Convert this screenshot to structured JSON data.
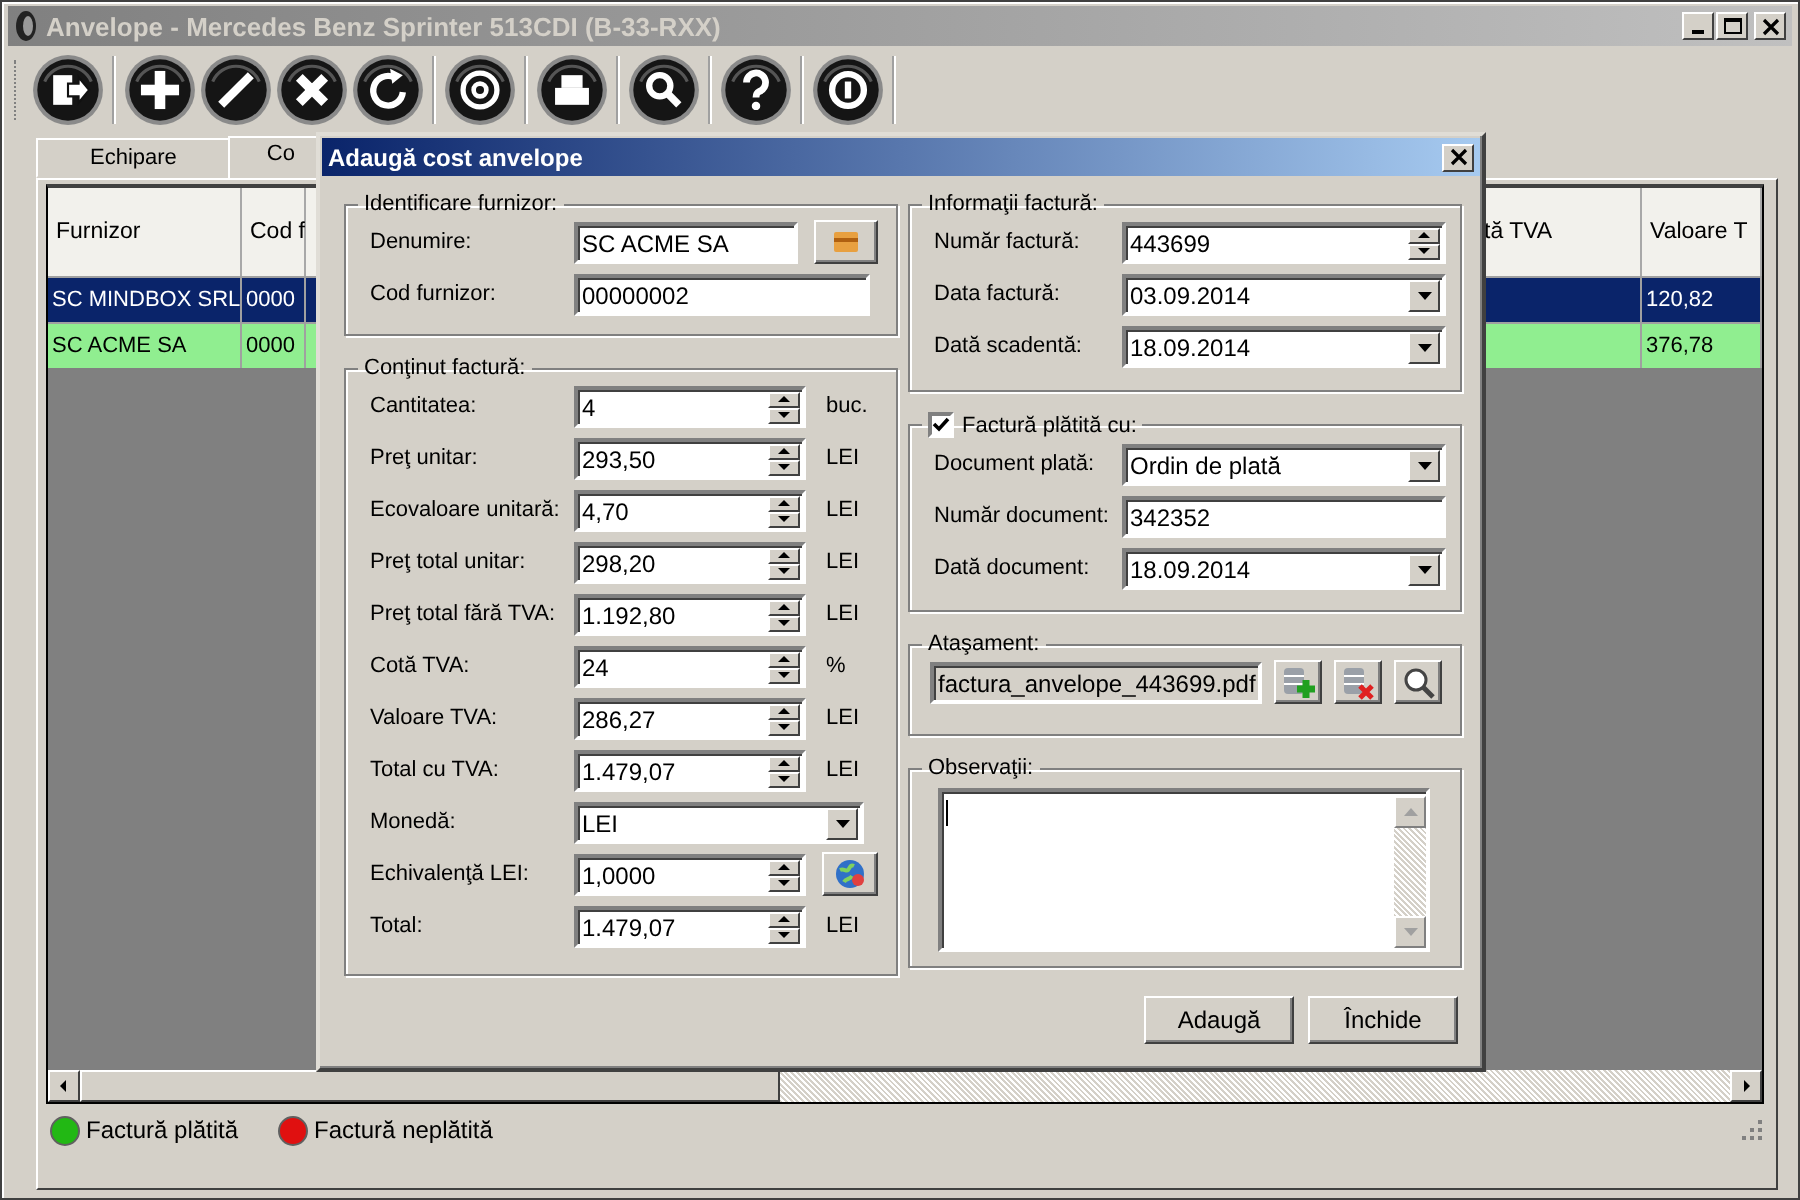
{
  "window": {
    "title": "Anvelope - Mercedes Benz Sprinter 513CDI (B-33-RXX)"
  },
  "tabs": [
    {
      "label": "Echipare",
      "selected": false
    },
    {
      "label": "Co",
      "selected": true
    }
  ],
  "table": {
    "columns": [
      "Furnizor",
      "Cod f",
      "tă TVA",
      "Valoare T"
    ],
    "rows": [
      {
        "cells": [
          "SC MINDBOX SRL",
          "0000",
          null,
          "120,82"
        ],
        "selected": true
      },
      {
        "cells": [
          "SC ACME SA",
          "0000",
          null,
          "376,78"
        ],
        "selected": false,
        "color": "#90ee90"
      }
    ]
  },
  "legend": [
    {
      "label": "Factură plătită",
      "color": "#22b814"
    },
    {
      "label": "Factură neplătită",
      "color": "#e01010"
    }
  ],
  "dialog": {
    "title": "Adaugă cost anvelope",
    "supplier": {
      "legend": "Identificare furnizor:",
      "fields": [
        {
          "label": "Denumire:",
          "value": "SC ACME SA",
          "kind": "browse"
        },
        {
          "label": "Cod furnizor:",
          "value": "00000002",
          "kind": "text"
        }
      ]
    },
    "content": {
      "legend": "Conţinut factură:",
      "fields": [
        {
          "label": "Cantitatea:",
          "value": "4",
          "unit": "buc.",
          "kind": "spin"
        },
        {
          "label": "Preţ unitar:",
          "value": "293,50",
          "unit": "LEI",
          "kind": "spin"
        },
        {
          "label": "Ecovaloare unitară:",
          "value": "4,70",
          "unit": "LEI",
          "kind": "spin"
        },
        {
          "label": "Preţ total unitar:",
          "value": "298,20",
          "unit": "LEI",
          "kind": "spin"
        },
        {
          "label": "Preţ total fără TVA:",
          "value": "1.192,80",
          "unit": "LEI",
          "kind": "spin"
        },
        {
          "label": "Cotă TVA:",
          "value": "24",
          "unit": "%",
          "kind": "spin"
        },
        {
          "label": "Valoare TVA:",
          "value": "286,27",
          "unit": "LEI",
          "kind": "spin"
        },
        {
          "label": "Total cu TVA:",
          "value": "1.479,07",
          "unit": "LEI",
          "kind": "spin"
        },
        {
          "label": "Monedă:",
          "value": "LEI",
          "kind": "combo"
        },
        {
          "label": "Echivalenţă LEI:",
          "value": "1,0000",
          "kind": "spin-globe"
        },
        {
          "label": "Total:",
          "value": "1.479,07",
          "unit": "LEI",
          "kind": "spin"
        }
      ]
    },
    "invoice": {
      "legend": "Informaţii factură:",
      "fields": [
        {
          "label": "Număr factură:",
          "value": "443699",
          "kind": "spin"
        },
        {
          "label": "Data factură:",
          "value": "03.09.2014",
          "kind": "combo"
        },
        {
          "label": "Dată scadentă:",
          "value": "18.09.2014",
          "kind": "combo"
        }
      ]
    },
    "payment": {
      "legend": "Factură plătită cu:",
      "checked": true,
      "fields": [
        {
          "label": "Document plată:",
          "value": "Ordin de plată",
          "kind": "combo"
        },
        {
          "label": "Număr document:",
          "value": "342352",
          "kind": "text"
        },
        {
          "label": "Dată document:",
          "value": "18.09.2014",
          "kind": "combo"
        }
      ]
    },
    "attachment": {
      "legend": "Ataşament:",
      "file": "factura_anvelope_443699.pdf"
    },
    "notes": {
      "legend": "Observaţii:"
    },
    "buttons": [
      "Adaugă",
      "Închide"
    ]
  }
}
